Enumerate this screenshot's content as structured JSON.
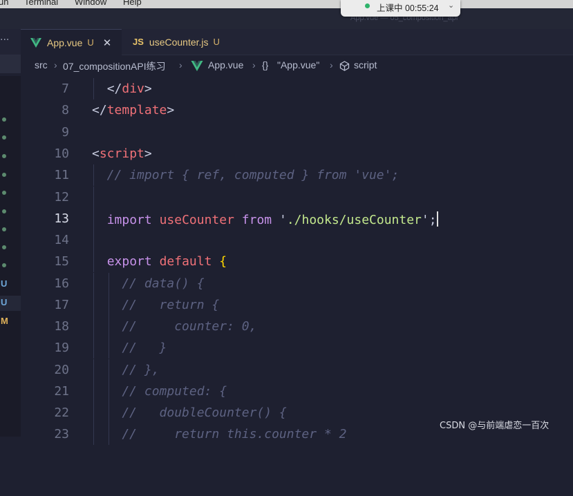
{
  "menubar": {
    "items": [
      "un",
      "Terminal",
      "Window",
      "Help"
    ]
  },
  "window": {
    "title": "App.vue — 05_composition_api"
  },
  "recording": {
    "text": "上课中 00:55:24",
    "indicator_color": "#2fb36b"
  },
  "tabs": [
    {
      "icon": "vue-icon",
      "name": "App.vue",
      "status": "U",
      "active": true
    },
    {
      "icon": "js-icon",
      "icon_text": "JS",
      "name": "useCounter.js",
      "status": "U",
      "active": false
    }
  ],
  "breadcrumb": {
    "parts": [
      "src",
      "07_compositionAPI练习",
      "App.vue",
      "\"App.vue\"",
      "script"
    ],
    "object_glyph": "{}"
  },
  "gutter": {
    "letters": [
      "U",
      "U",
      "M"
    ]
  },
  "editor": {
    "current_line": 13,
    "lines": [
      {
        "n": "7",
        "text": "  </div>"
      },
      {
        "n": "8",
        "text": "</template>"
      },
      {
        "n": "9",
        "text": ""
      },
      {
        "n": "10",
        "text": "<script>"
      },
      {
        "n": "11",
        "text": "  // import { ref, computed } from 'vue';"
      },
      {
        "n": "12",
        "text": ""
      },
      {
        "n": "13",
        "text": "  import useCounter from './hooks/useCounter';"
      },
      {
        "n": "14",
        "text": ""
      },
      {
        "n": "15",
        "text": "  export default {"
      },
      {
        "n": "16",
        "text": "    // data() {"
      },
      {
        "n": "17",
        "text": "    //   return {"
      },
      {
        "n": "18",
        "text": "    //     counter: 0,"
      },
      {
        "n": "19",
        "text": "    //   }"
      },
      {
        "n": "20",
        "text": "    // },"
      },
      {
        "n": "21",
        "text": "    // computed: {"
      },
      {
        "n": "22",
        "text": "    //   doubleCounter() {"
      },
      {
        "n": "23",
        "text": "    //     return this.counter * 2"
      }
    ]
  },
  "watermark": "CSDN @与前端虐恋一百次",
  "colors": {
    "tag": "#f07178",
    "keyword": "#c792ea",
    "string": "#c3e88d",
    "comment": "#5d6282",
    "brace": "#ffd700"
  }
}
